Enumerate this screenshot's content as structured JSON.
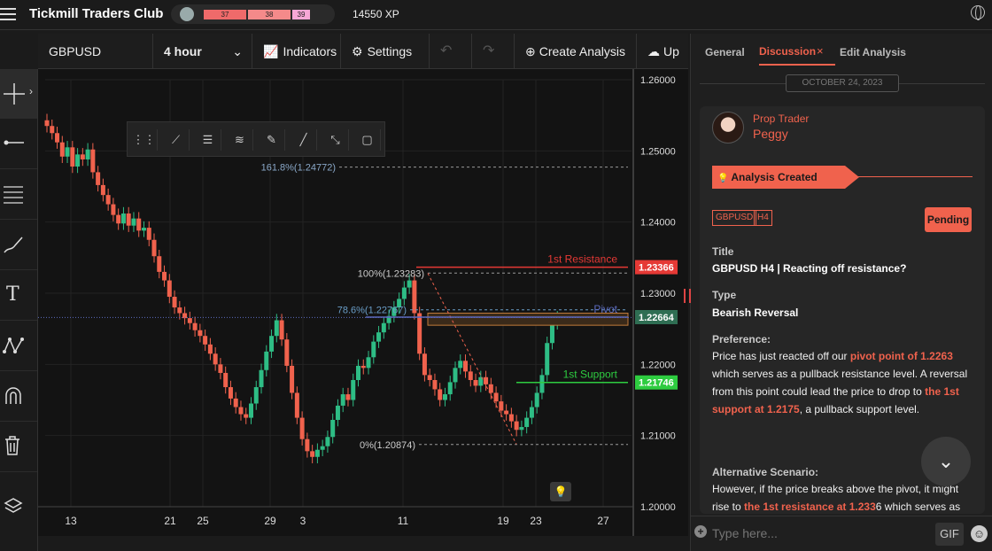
{
  "app": {
    "title": "Tickmill Traders Club",
    "xp": "14550 XP",
    "levels": [
      "37",
      "38",
      "39"
    ]
  },
  "toolbar": {
    "symbol": "GBPUSD",
    "timeframe": "4 hour",
    "indicators": "Indicators",
    "settings": "Settings",
    "create": "Create Analysis",
    "upload": "Up"
  },
  "chart_data": {
    "type": "candlestick",
    "symbol": "GBPUSD",
    "timeframe": "4 hour",
    "y_ticks": [
      "1.26000",
      "1.25000",
      "1.24000",
      "1.23000",
      "1.22000",
      "1.21000",
      "1.20000"
    ],
    "ylim": [
      1.2,
      1.26
    ],
    "x_ticks": [
      "13",
      "21",
      "25",
      "29",
      "3",
      "11",
      "19",
      "23",
      "27"
    ],
    "fib_levels": [
      {
        "label": "161.8%(1.24772)",
        "value": 1.24772
      },
      {
        "label": "100%(1.23283)",
        "value": 1.23283
      },
      {
        "label": "78.6%(1.22767)",
        "value": 1.22767
      },
      {
        "label": "0%(1.20874)",
        "value": 1.20874
      }
    ],
    "lines": [
      {
        "name": "1st Resistance",
        "value": 1.23366,
        "color": "#e53935"
      },
      {
        "name": "Pivot",
        "value": 1.22664,
        "color": "#5c6bc0"
      },
      {
        "name": "1st Support",
        "value": 1.21746,
        "color": "#2ecc40"
      }
    ],
    "badges": {
      "resistance": "1.23366",
      "pivot": "1.22664",
      "support": "1.21746"
    },
    "close_series": [
      1.2535,
      1.2525,
      1.2512,
      1.2492,
      1.2505,
      1.2478,
      1.2495,
      1.2488,
      1.2502,
      1.247,
      1.2452,
      1.2438,
      1.2425,
      1.241,
      1.2398,
      1.2412,
      1.2395,
      1.2405,
      1.2388,
      1.2392,
      1.2375,
      1.2352,
      1.233,
      1.2318,
      1.2295,
      1.228,
      1.2272,
      1.2265,
      1.2258,
      1.2248,
      1.224,
      1.2228,
      1.2215,
      1.22,
      1.2188,
      1.2168,
      1.2152,
      1.214,
      1.213,
      1.2125,
      1.2145,
      1.2168,
      1.2192,
      1.2218,
      1.224,
      1.2262,
      1.2235,
      1.2198,
      1.216,
      1.2125,
      1.2095,
      1.2078,
      1.207,
      1.208,
      1.2085,
      1.2098,
      1.2122,
      1.2142,
      1.2158,
      1.215,
      1.2178,
      1.2198,
      1.2195,
      1.221,
      1.2232,
      1.2245,
      1.2258,
      1.2268,
      1.228,
      1.2292,
      1.2308,
      1.2318,
      1.2272,
      1.2215,
      1.2185,
      1.2178,
      1.2165,
      1.215,
      1.2158,
      1.2175,
      1.2195,
      1.2205,
      1.219,
      1.2178,
      1.217,
      1.2182,
      1.2172,
      1.216,
      1.2148,
      1.2135,
      1.213,
      1.212,
      1.2108,
      1.2112,
      1.2125,
      1.214,
      1.216,
      1.2185,
      1.223,
      1.2258,
      1.2266
    ]
  },
  "drawing_tools": [
    "drag-handle",
    "trendline",
    "fib",
    "channel",
    "brush",
    "line",
    "path",
    "rectangle"
  ],
  "panel": {
    "tabs": [
      "General",
      "Discussion",
      "Edit Analysis"
    ],
    "date": "OCTOBER 24, 2023",
    "user": {
      "role": "Prop Trader",
      "name": "Peggy"
    },
    "banner": "Analysis Created",
    "tags": [
      "GBPUSD",
      "H4"
    ],
    "status": "Pending",
    "title_label": "Title",
    "title_value": "GBPUSD H4 | Reacting off resistance?",
    "type_label": "Type",
    "type_value": "Bearish Reversal",
    "pref_label": "Preference:",
    "pref_text": [
      "Price has just reacted off our ",
      "pivot point of 1.2263",
      " which serves as a pullback resistance level. A reversal from this point could lead the price to drop to ",
      "the 1st support at 1.2175",
      ", a pullback support level."
    ],
    "alt_label": "Alternative Scenario:",
    "alt_text": [
      "However, if the price breaks above the pivot, it might rise to ",
      "the 1st resistance at 1.233",
      "6 which serves as a"
    ],
    "input_placeholder": "Type here...",
    "gif": "GIF"
  }
}
